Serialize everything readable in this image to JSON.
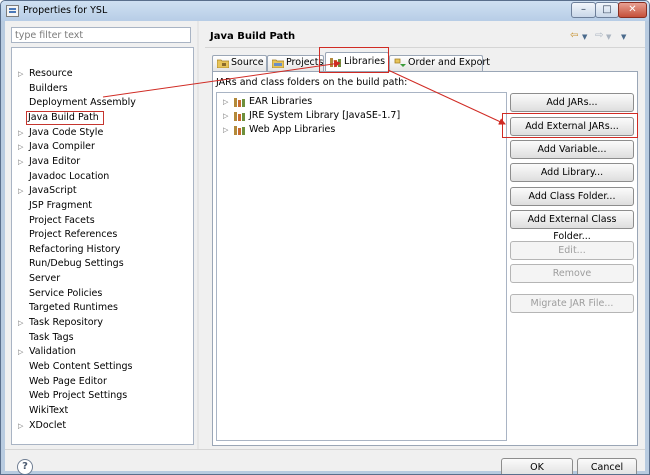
{
  "window": {
    "title": "Properties for YSL",
    "controls": {
      "minimize": "–",
      "maximize": "□",
      "close": "✕"
    }
  },
  "filter": {
    "placeholder": "type filter text"
  },
  "tree": {
    "items": [
      {
        "label": "Resource",
        "expandable": true
      },
      {
        "label": "Builders",
        "expandable": false
      },
      {
        "label": "Deployment Assembly",
        "expandable": false
      },
      {
        "label": "Java Build Path",
        "expandable": false,
        "selected": true
      },
      {
        "label": "Java Code Style",
        "expandable": true
      },
      {
        "label": "Java Compiler",
        "expandable": true
      },
      {
        "label": "Java Editor",
        "expandable": true
      },
      {
        "label": "Javadoc Location",
        "expandable": false
      },
      {
        "label": "JavaScript",
        "expandable": true
      },
      {
        "label": "JSP Fragment",
        "expandable": false
      },
      {
        "label": "Project Facets",
        "expandable": false
      },
      {
        "label": "Project References",
        "expandable": false
      },
      {
        "label": "Refactoring History",
        "expandable": false
      },
      {
        "label": "Run/Debug Settings",
        "expandable": false
      },
      {
        "label": "Server",
        "expandable": false
      },
      {
        "label": "Service Policies",
        "expandable": false
      },
      {
        "label": "Targeted Runtimes",
        "expandable": false
      },
      {
        "label": "Task Repository",
        "expandable": true
      },
      {
        "label": "Task Tags",
        "expandable": false
      },
      {
        "label": "Validation",
        "expandable": true
      },
      {
        "label": "Web Content Settings",
        "expandable": false
      },
      {
        "label": "Web Page Editor",
        "expandable": false
      },
      {
        "label": "Web Project Settings",
        "expandable": false
      },
      {
        "label": "WikiText",
        "expandable": false
      },
      {
        "label": "XDoclet",
        "expandable": true
      }
    ]
  },
  "page": {
    "title": "Java Build Path",
    "tabs": {
      "source": "Source",
      "projects": "Projects",
      "libraries": "Libraries",
      "order": "Order and Export"
    },
    "active_tab": "Libraries",
    "libraries_label": "JARs and class folders on the build path:",
    "libraries": [
      "EAR Libraries",
      "JRE System Library [JavaSE-1.7]",
      "Web App Libraries"
    ],
    "buttons": {
      "add_jars": "Add JARs...",
      "add_external_jars": "Add External JARs...",
      "add_variable": "Add Variable...",
      "add_library": "Add Library...",
      "add_class_folder": "Add Class Folder...",
      "add_external_class_folder": "Add External Class Folder...",
      "edit": "Edit...",
      "remove": "Remove",
      "migrate_jar": "Migrate JAR File..."
    }
  },
  "footer": {
    "help": "?",
    "ok": "OK",
    "cancel": "Cancel"
  },
  "colors": {
    "annotation": "#d02b24",
    "title_bar": "#b8cbe0"
  }
}
